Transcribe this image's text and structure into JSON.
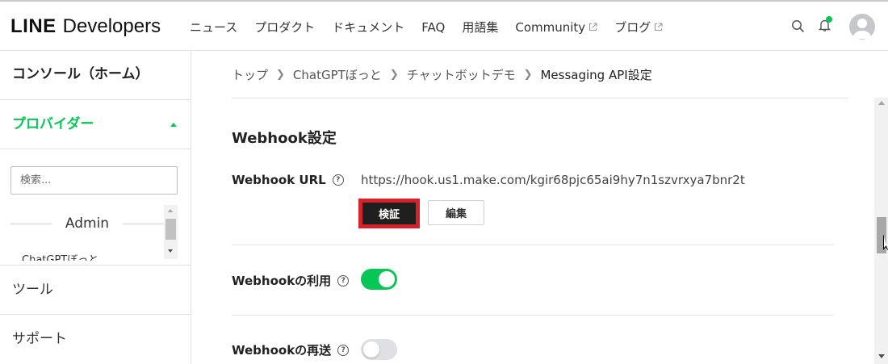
{
  "header": {
    "logo_brand": "LINE",
    "logo_sub": "Developers",
    "nav": [
      {
        "label": "ニュース",
        "external": false
      },
      {
        "label": "プロダクト",
        "external": false
      },
      {
        "label": "ドキュメント",
        "external": false
      },
      {
        "label": "FAQ",
        "external": false
      },
      {
        "label": "用語集",
        "external": false
      },
      {
        "label": "Community",
        "external": true
      },
      {
        "label": "ブログ",
        "external": true
      }
    ],
    "icons": [
      "search-icon",
      "bell-icon",
      "avatar"
    ]
  },
  "sidebar": {
    "home": "コンソール（ホーム）",
    "provider": "プロバイダー",
    "search_placeholder": "検索...",
    "admin_label": "Admin",
    "provider_item": "ChatGPTぼっと",
    "tool": "ツール",
    "support": "サポート"
  },
  "breadcrumb": [
    "トップ",
    "ChatGPTぼっと",
    "チャットボットデモ",
    "Messaging API設定"
  ],
  "main": {
    "section_title": "Webhook設定",
    "webhook_url_label": "Webhook URL",
    "webhook_url": "https://hook.us1.make.com/kgir68pjc65ai9hy7n1szvrxya7bnr2t",
    "verify_button": "検証",
    "edit_button": "編集",
    "use_webhook_label": "Webhookの利用",
    "use_webhook": true,
    "redelivery_label": "Webhookの再送",
    "redelivery": false
  },
  "colors": {
    "accent": "#06c755",
    "highlight": "#d6202a",
    "dark_button": "#1f1f1f"
  }
}
